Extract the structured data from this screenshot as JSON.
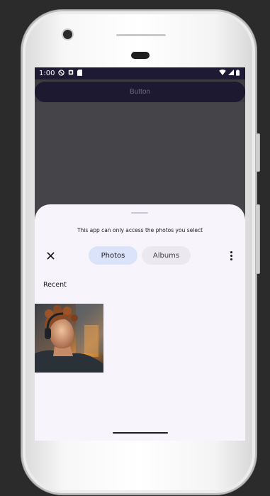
{
  "status_bar": {
    "time": "1:00",
    "icons": [
      "do-not-disturb-icon",
      "notification-icon",
      "sim-card-icon",
      "wifi-icon",
      "signal-icon",
      "battery-icon"
    ]
  },
  "app": {
    "button_label": "Button"
  },
  "picker": {
    "notice": "This app can only access the photos you select",
    "tabs": [
      {
        "label": "Photos",
        "selected": true
      },
      {
        "label": "Albums",
        "selected": false
      }
    ],
    "section_label": "Recent",
    "photos": [
      {
        "description_icon": "photo-thumbnail"
      }
    ]
  },
  "colors": {
    "status_bar_bg": "#1e1a33",
    "sheet_bg": "#f7f4fb",
    "selected_tab_bg": "#dbe3fb",
    "unselected_tab_bg": "#ebe9ef"
  }
}
